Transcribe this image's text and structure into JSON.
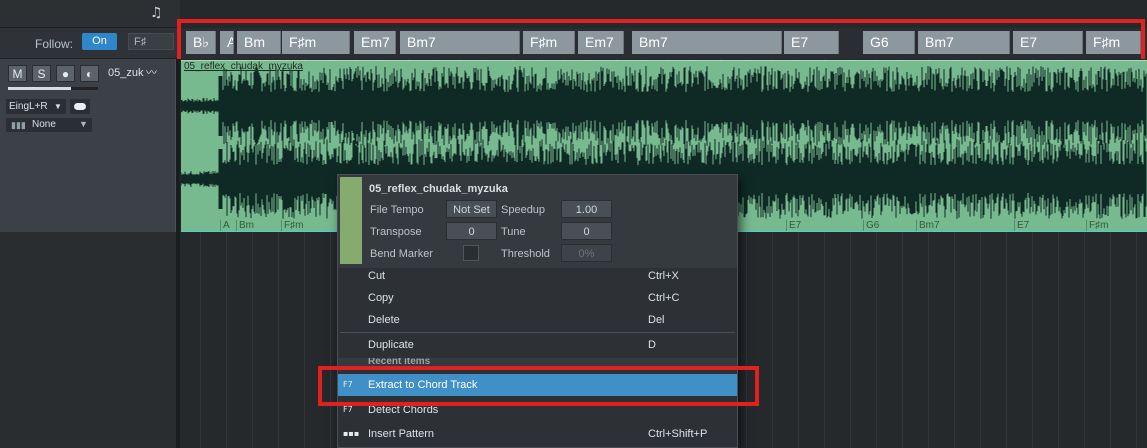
{
  "header": {
    "note_icon": "music-note-icon"
  },
  "follow": {
    "label": "Follow:",
    "on_label": "On",
    "key_value": "F♯"
  },
  "track": {
    "buttons": [
      "M",
      "S",
      "●",
      "◐"
    ],
    "name": "05_zuk",
    "input": "EingL+R",
    "output": "None",
    "volume_fraction": 0.7
  },
  "chord_track": {
    "chords": [
      "B♭",
      "A",
      "Bm",
      "F♯m",
      "Em7",
      "Bm7",
      "F♯m",
      "Em7",
      "Bm7",
      "E7",
      "G6",
      "Bm7",
      "E7",
      "F♯m"
    ]
  },
  "event": {
    "title": "05_reflex_chudak_myzuka",
    "chord_labels": [
      "A",
      "Bm",
      "F♯m",
      "E7",
      "G6",
      "Bm7",
      "E7",
      "F♯m"
    ]
  },
  "menu": {
    "title": "05_reflex_chudak_myzuka",
    "file_tempo_label": "File Tempo",
    "file_tempo_value": "Not Set",
    "speedup_label": "Speedup",
    "speedup_value": "1.00",
    "transpose_label": "Transpose",
    "transpose_value": "0",
    "tune_label": "Tune",
    "tune_value": "0",
    "bend_marker_label": "Bend Marker",
    "threshold_label": "Threshold",
    "threshold_value": "0%",
    "items": {
      "cut": {
        "label": "Cut",
        "shortcut": "Ctrl+X"
      },
      "copy": {
        "label": "Copy",
        "shortcut": "Ctrl+C"
      },
      "delete": {
        "label": "Delete",
        "shortcut": "Del"
      },
      "duplicate": {
        "label": "Duplicate",
        "shortcut": "D"
      },
      "extract": {
        "label": "Extract to Chord Track",
        "icon_text": "F7"
      },
      "detect": {
        "label": "Detect Chords",
        "icon_text": "F7"
      },
      "insert_pattern": {
        "label": "Insert Pattern",
        "shortcut": "Ctrl+Shift+P"
      }
    },
    "recent_header": "Recent items"
  },
  "colors": {
    "accent": "#4090c8",
    "event_green": "#78ba90",
    "highlight_red": "#e0211f",
    "chord_gray": "#8d979e"
  }
}
